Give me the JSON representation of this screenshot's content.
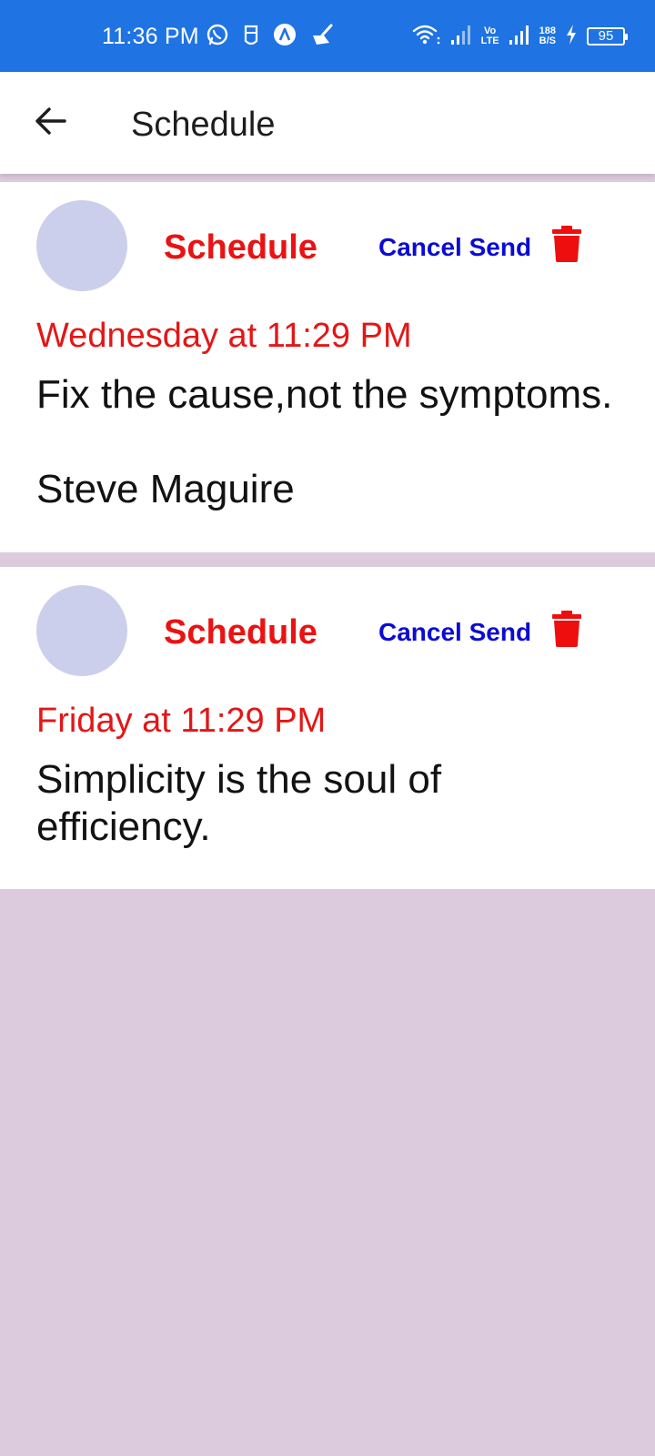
{
  "status_bar": {
    "time": "11:36 PM",
    "network_speed_value": "188",
    "network_speed_unit": "B/S",
    "volte_top": "Vo",
    "volte_bottom": "LTE",
    "battery": "95",
    "left_icons": [
      "whatsapp-icon",
      "app-icon",
      "maps-icon",
      "cleaner-icon"
    ],
    "right_icons": [
      "wifi-icon",
      "signal-icon",
      "volte-icon",
      "signal-icon",
      "charging-icon",
      "battery-icon"
    ]
  },
  "app_bar": {
    "title": "Schedule",
    "back_icon": "arrow-left-icon"
  },
  "colors": {
    "status_bar": "#1f73e2",
    "label_red": "#ea1212",
    "date_red": "#e21717",
    "cancel_blue": "#0b0bd3",
    "avatar": "#cccfec",
    "background": "#dccbdc"
  },
  "cards": [
    {
      "label": "Schedule",
      "cancel_label": "Cancel Send",
      "delete_icon": "trash-icon",
      "date": "Wednesday at 11:29 PM",
      "message": "Fix the cause,not the symptoms.\n\nSteve Maguire"
    },
    {
      "label": "Schedule",
      "cancel_label": "Cancel Send",
      "delete_icon": "trash-icon",
      "date": "Friday at 11:29 PM",
      "message": "Simplicity is the soul of efficiency."
    }
  ]
}
